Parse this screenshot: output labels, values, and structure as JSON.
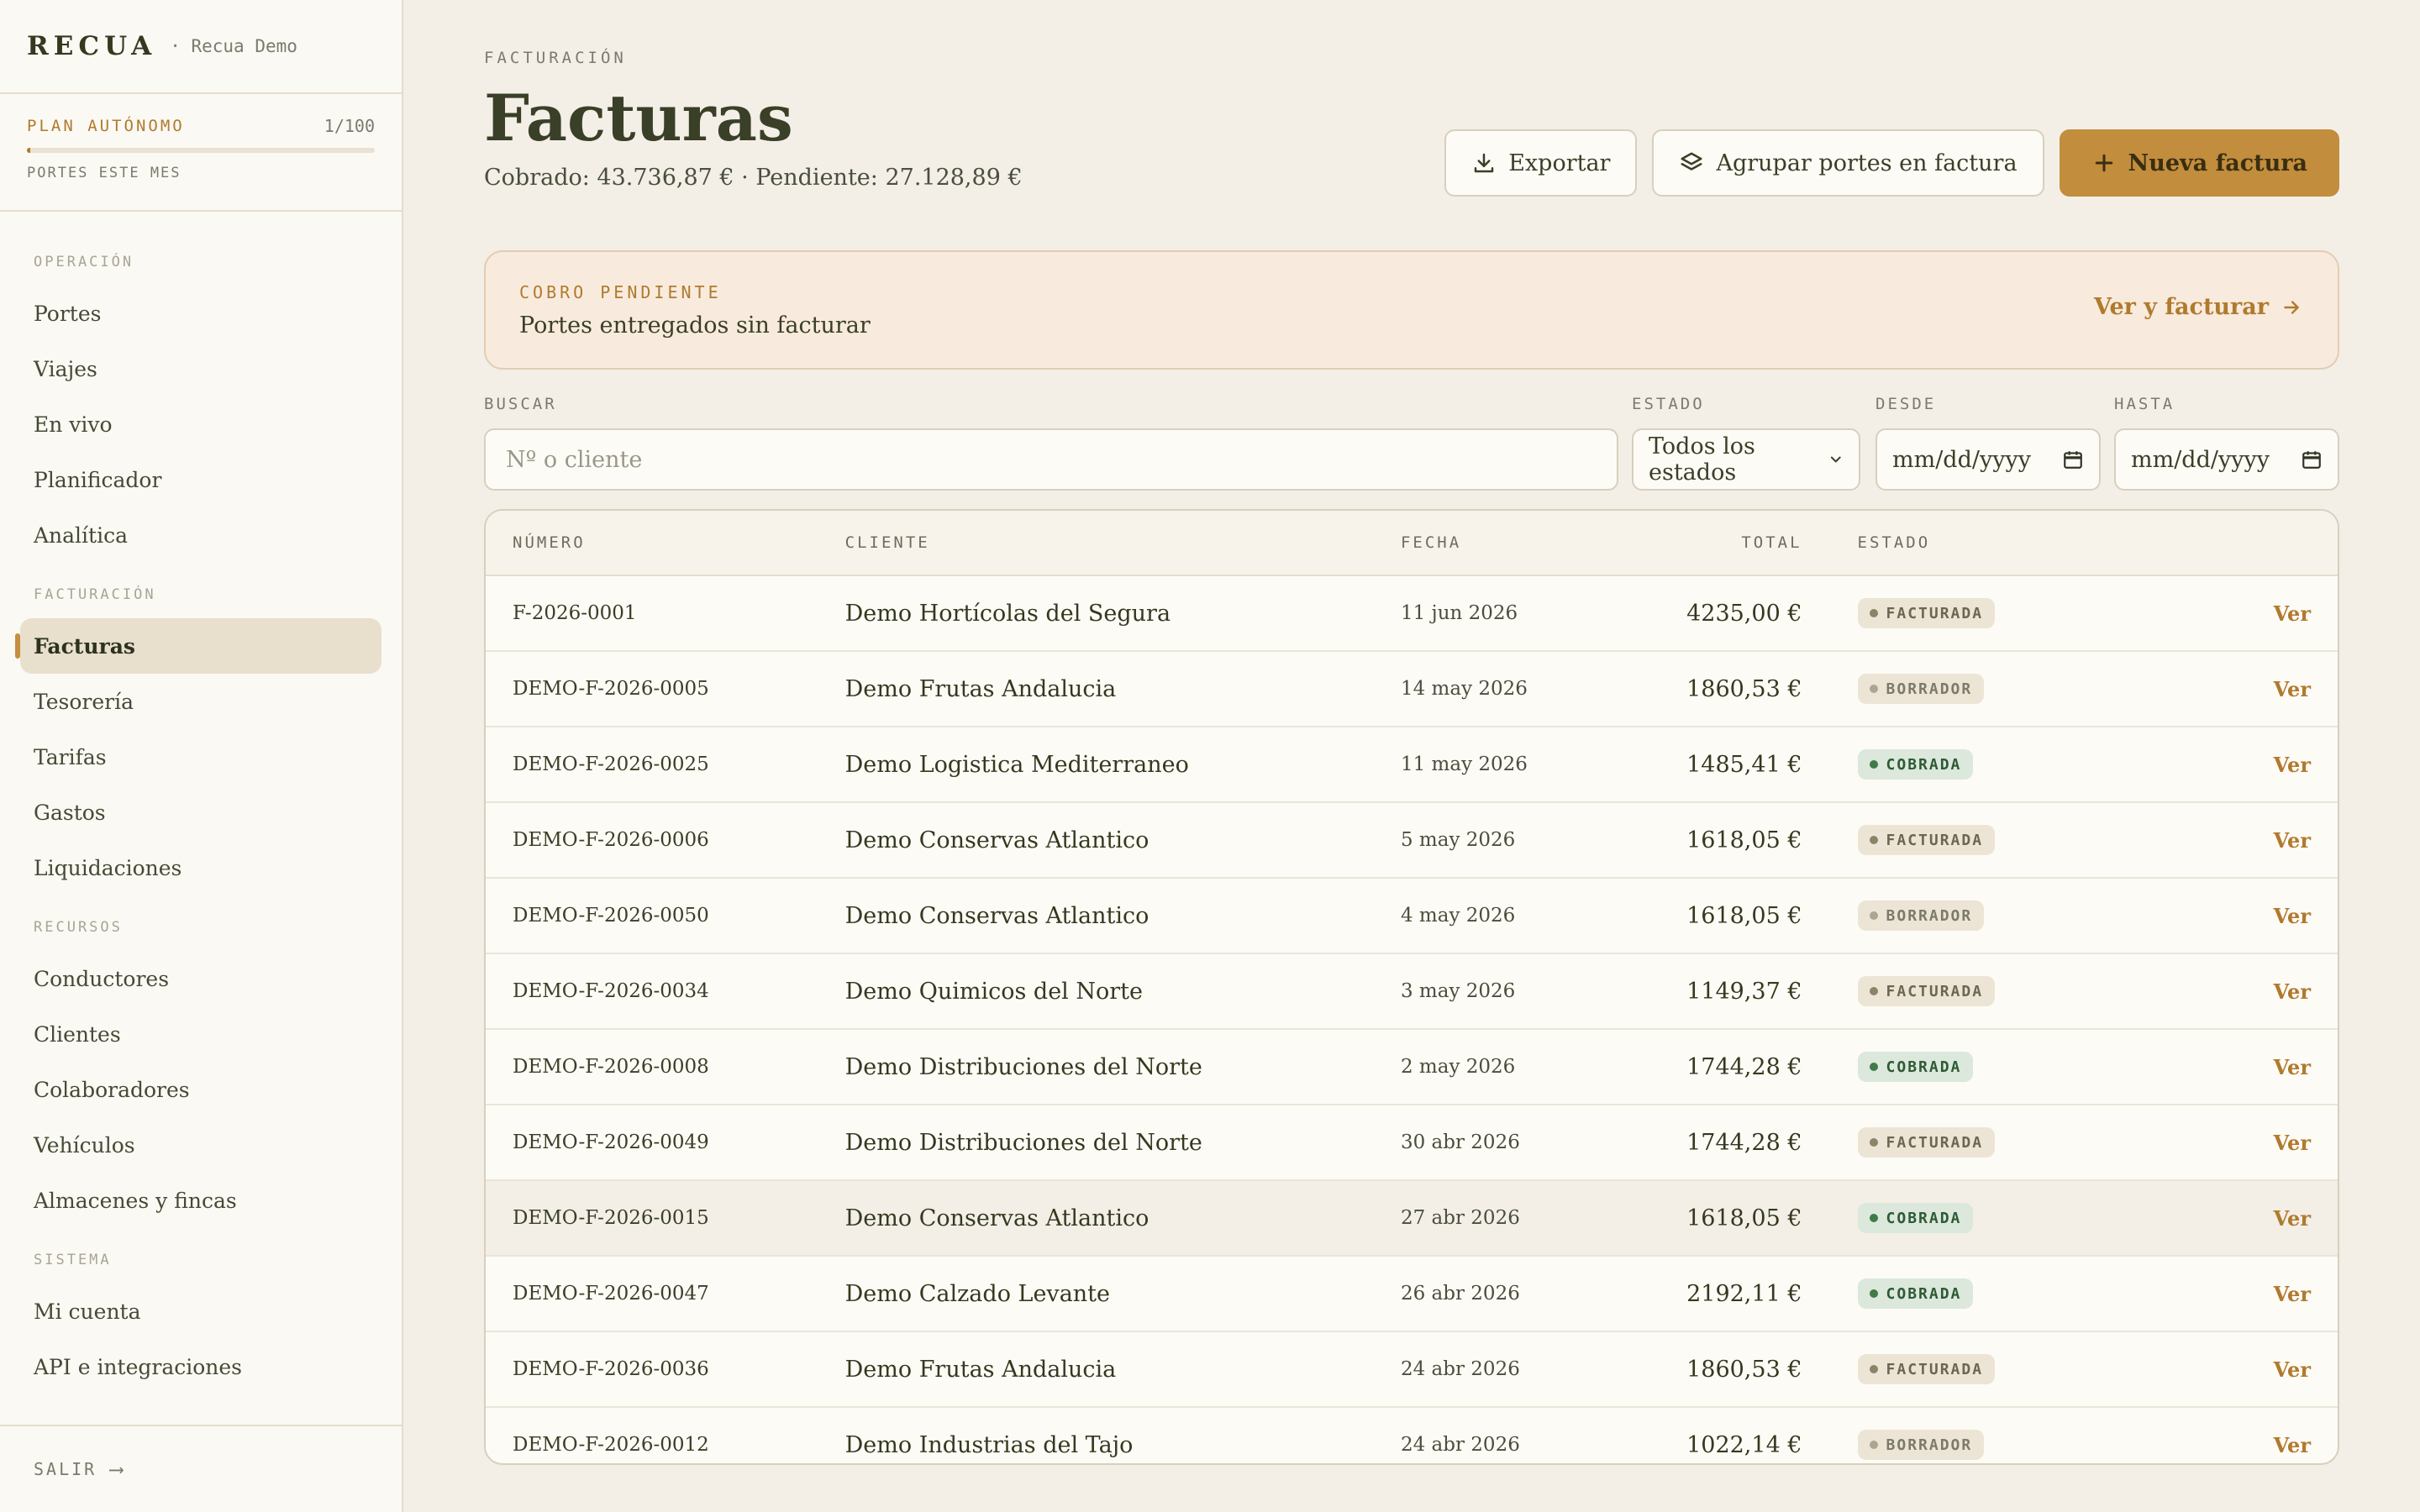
{
  "brand": {
    "name": "RECUA",
    "workspace": "· Recua Demo"
  },
  "plan": {
    "name": "PLAN AUTÓNOMO",
    "count": "1/100",
    "caption": "PORTES ESTE MES",
    "progress": 0.01
  },
  "nav": {
    "sections": [
      {
        "title": "OPERACIÓN",
        "items": [
          "Portes",
          "Viajes",
          "En vivo",
          "Planificador",
          "Analítica"
        ]
      },
      {
        "title": "FACTURACIÓN",
        "items": [
          "Facturas",
          "Tesorería",
          "Tarifas",
          "Gastos",
          "Liquidaciones"
        ]
      },
      {
        "title": "RECURSOS",
        "items": [
          "Conductores",
          "Clientes",
          "Colaboradores",
          "Vehículos",
          "Almacenes y fincas"
        ]
      },
      {
        "title": "SISTEMA",
        "items": [
          "Mi cuenta",
          "API e integraciones"
        ]
      }
    ],
    "active": "Facturas",
    "logout": "SALIR"
  },
  "header": {
    "eyebrow": "FACTURACIÓN",
    "title": "Facturas",
    "summary": "Cobrado: 43.736,87 € · Pendiente: 27.128,89 €"
  },
  "actions": {
    "export": "Exportar",
    "group": "Agrupar portes en factura",
    "new": "Nueva factura"
  },
  "alert": {
    "eyebrow": "COBRO PENDIENTE",
    "text": "Portes entregados sin facturar",
    "link": "Ver y facturar"
  },
  "filters": {
    "search_label": "BUSCAR",
    "search_placeholder": "Nº o cliente",
    "status_label": "ESTADO",
    "status_value": "Todos los estados",
    "from_label": "DESDE",
    "from_value": "mm/dd/yyyy",
    "to_label": "HASTA",
    "to_value": "mm/dd/yyyy"
  },
  "table": {
    "headers": {
      "number": "NÚMERO",
      "client": "CLIENTE",
      "date": "FECHA",
      "total": "TOTAL",
      "status": "ESTADO"
    },
    "action_label": "Ver",
    "rows": [
      {
        "number": "F-2026-0001",
        "client": "Demo Hortícolas del Segura",
        "date": "11 jun 2026",
        "total": "4235,00 €",
        "status": "FACTURADA",
        "kind": "facturada"
      },
      {
        "number": "DEMO-F-2026-0005",
        "client": "Demo Frutas Andalucia",
        "date": "14 may 2026",
        "total": "1860,53 €",
        "status": "BORRADOR",
        "kind": "borrador"
      },
      {
        "number": "DEMO-F-2026-0025",
        "client": "Demo Logistica Mediterraneo",
        "date": "11 may 2026",
        "total": "1485,41 €",
        "status": "COBRADA",
        "kind": "cobrada"
      },
      {
        "number": "DEMO-F-2026-0006",
        "client": "Demo Conservas Atlantico",
        "date": "5 may 2026",
        "total": "1618,05 €",
        "status": "FACTURADA",
        "kind": "facturada"
      },
      {
        "number": "DEMO-F-2026-0050",
        "client": "Demo Conservas Atlantico",
        "date": "4 may 2026",
        "total": "1618,05 €",
        "status": "BORRADOR",
        "kind": "borrador"
      },
      {
        "number": "DEMO-F-2026-0034",
        "client": "Demo Quimicos del Norte",
        "date": "3 may 2026",
        "total": "1149,37 €",
        "status": "FACTURADA",
        "kind": "facturada"
      },
      {
        "number": "DEMO-F-2026-0008",
        "client": "Demo Distribuciones del Norte",
        "date": "2 may 2026",
        "total": "1744,28 €",
        "status": "COBRADA",
        "kind": "cobrada"
      },
      {
        "number": "DEMO-F-2026-0049",
        "client": "Demo Distribuciones del Norte",
        "date": "30 abr 2026",
        "total": "1744,28 €",
        "status": "FACTURADA",
        "kind": "facturada"
      },
      {
        "number": "DEMO-F-2026-0015",
        "client": "Demo Conservas Atlantico",
        "date": "27 abr 2026",
        "total": "1618,05 €",
        "status": "COBRADA",
        "kind": "cobrada"
      },
      {
        "number": "DEMO-F-2026-0047",
        "client": "Demo Calzado Levante",
        "date": "26 abr 2026",
        "total": "2192,11 €",
        "status": "COBRADA",
        "kind": "cobrada"
      },
      {
        "number": "DEMO-F-2026-0036",
        "client": "Demo Frutas Andalucia",
        "date": "24 abr 2026",
        "total": "1860,53 €",
        "status": "FACTURADA",
        "kind": "facturada"
      },
      {
        "number": "DEMO-F-2026-0012",
        "client": "Demo Industrias del Tajo",
        "date": "24 abr 2026",
        "total": "1022,14 €",
        "status": "BORRADOR",
        "kind": "borrador"
      }
    ],
    "highlighted_row": 8
  },
  "colors": {
    "accent": "#c28d3d",
    "background": "#f3efe7",
    "sidebar": "#fbf9f3",
    "cobrada": "#3f7a48"
  }
}
